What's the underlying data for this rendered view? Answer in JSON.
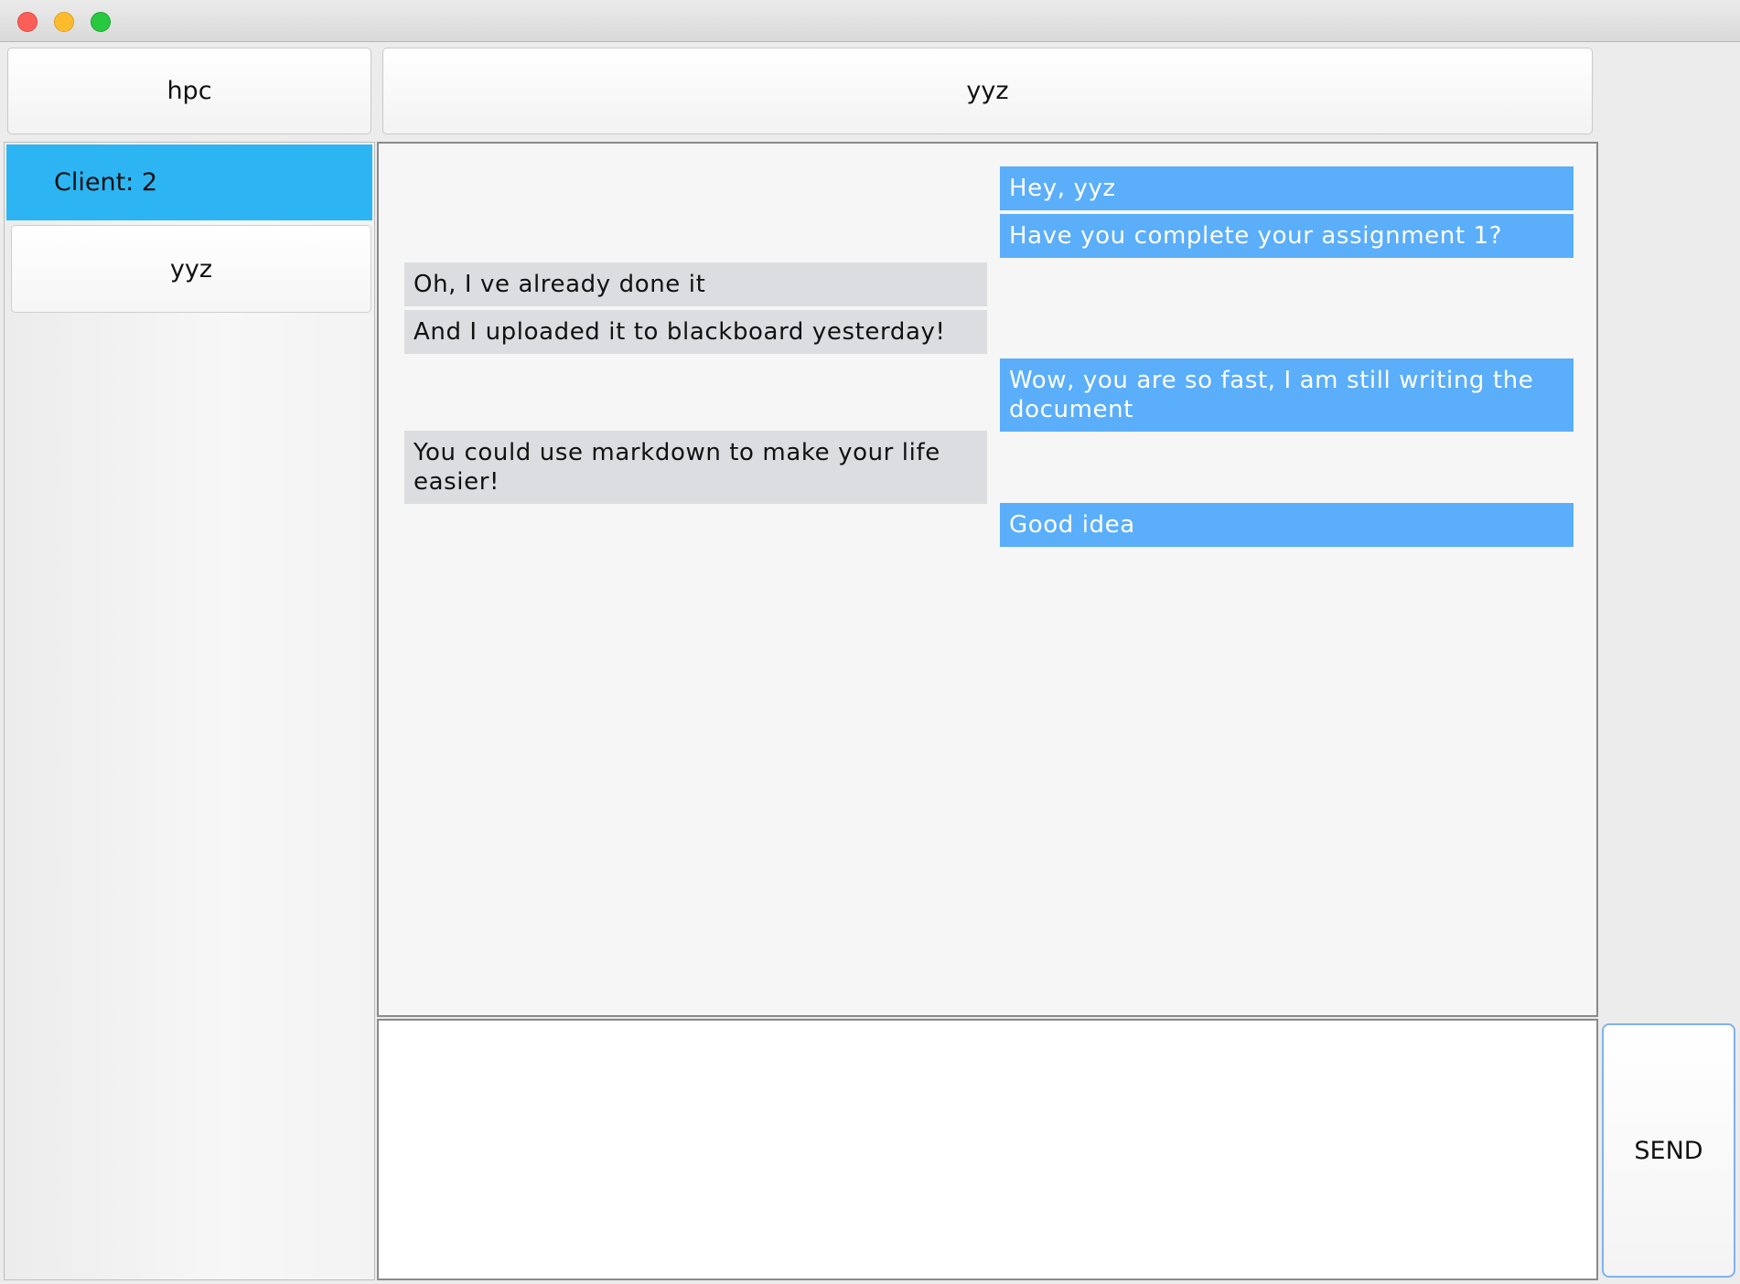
{
  "header": {
    "current_user": "hpc",
    "chat_peer": "yyz"
  },
  "sidebar": {
    "client_count_label": "Client: 2",
    "clients": [
      "yyz"
    ]
  },
  "messages": [
    {
      "side": "sent",
      "text": "Hey, yyz"
    },
    {
      "side": "sent",
      "text": "Have you complete your assignment 1?"
    },
    {
      "side": "recv",
      "text": "Oh, I ve already done it"
    },
    {
      "side": "recv",
      "text": "And I uploaded it to blackboard yesterday!"
    },
    {
      "side": "sent",
      "text": "Wow, you are so fast, I am still writing the document"
    },
    {
      "side": "recv",
      "text": "You could use markdown to make your life easier!"
    },
    {
      "side": "sent",
      "text": "Good idea"
    }
  ],
  "composer": {
    "value": "",
    "send_label": "SEND"
  },
  "colors": {
    "sent_bubble": "#5aaefa",
    "received_bubble": "#dcdde0",
    "selected_client_highlight": "#2db5f3",
    "close_button": "#fc5f57",
    "minimize_button": "#fdbc2e",
    "maximize_button": "#28c840"
  }
}
